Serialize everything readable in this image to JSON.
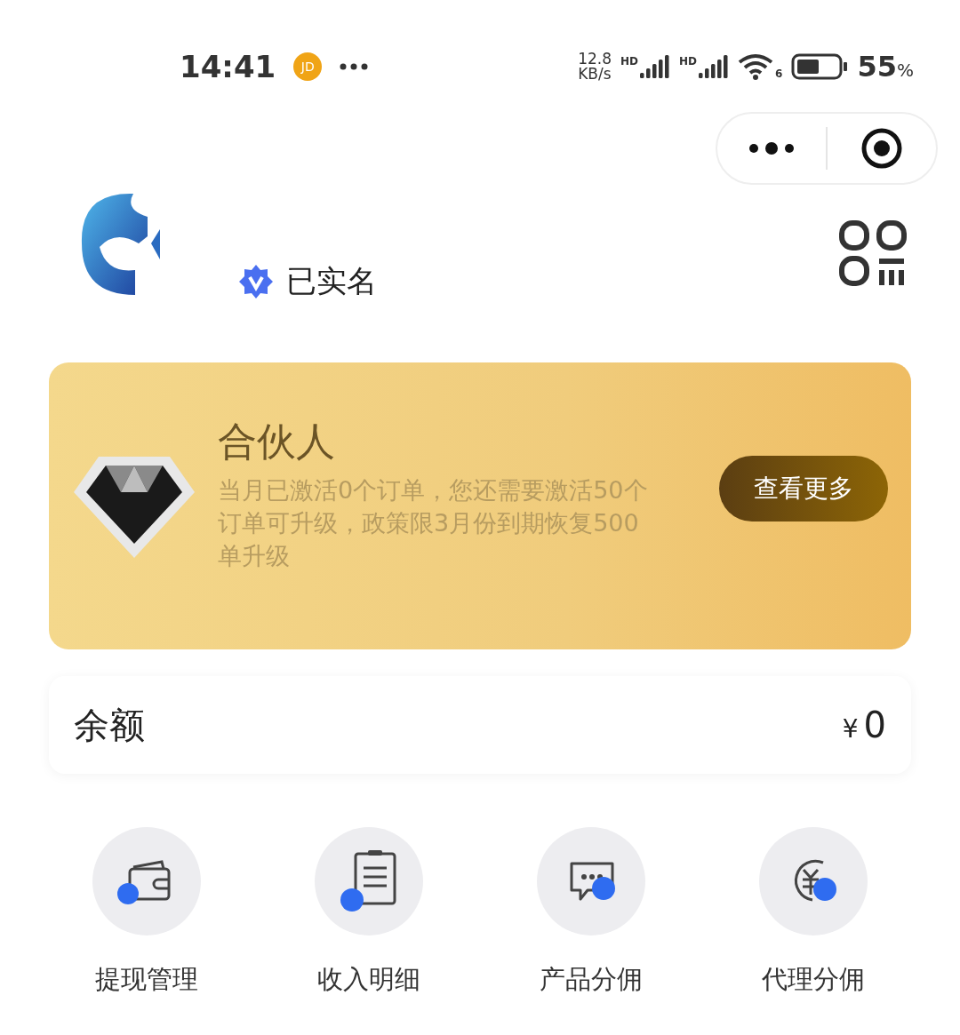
{
  "status_bar": {
    "time": "14:41",
    "app_badge": "JD",
    "net_speed": [
      "12.8",
      "KB/s"
    ],
    "signal_labels": [
      "HD",
      "HD"
    ],
    "wifi_label": "6",
    "battery_percent": "55",
    "percent_sign": "%"
  },
  "profile": {
    "verified_label": "已实名"
  },
  "member_card": {
    "title": "合伙人",
    "description": "当月已激活0个订单，您还需要激活50个订单可升级，政策限3月份到期恢复500单升级",
    "button": "查看更多"
  },
  "balance": {
    "label": "余额",
    "currency": "¥",
    "amount": "0"
  },
  "actions": [
    {
      "kind": "wallet",
      "label": "提现管理"
    },
    {
      "kind": "list",
      "label": "收入明细"
    },
    {
      "kind": "chat",
      "label": "产品分佣"
    },
    {
      "kind": "yuan",
      "label": "代理分佣"
    }
  ]
}
